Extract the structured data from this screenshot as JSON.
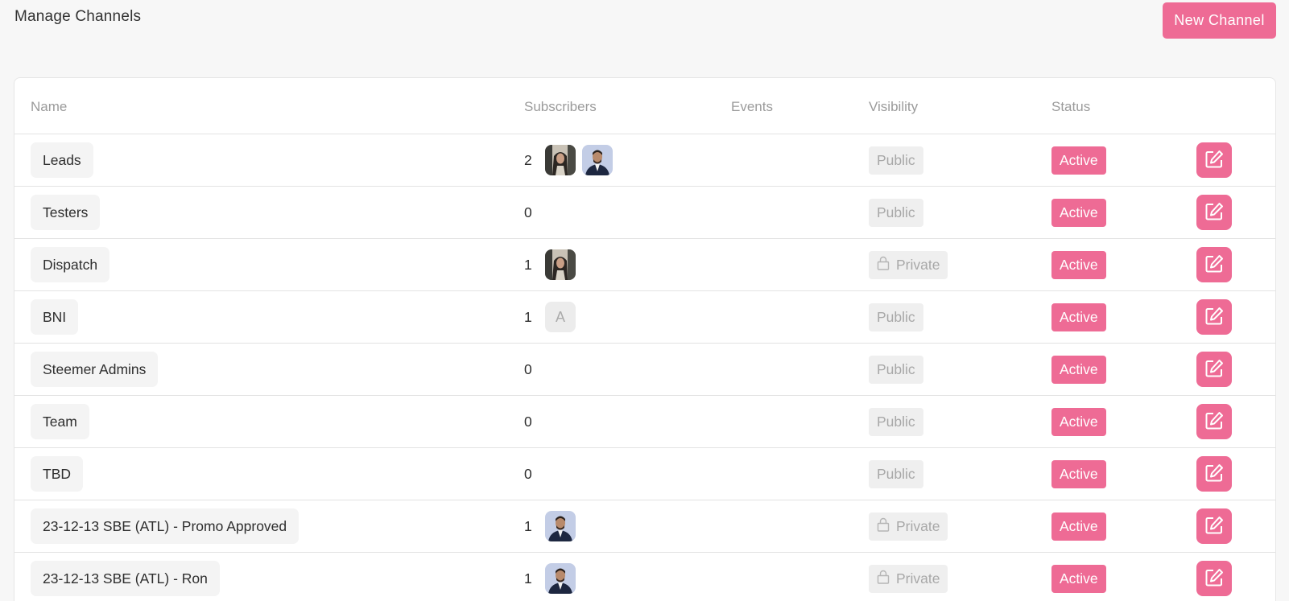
{
  "header": {
    "title": "Manage Channels",
    "new_button_label": "New Channel"
  },
  "table": {
    "columns": {
      "name": "Name",
      "subscribers": "Subscribers",
      "events": "Events",
      "visibility": "Visibility",
      "status": "Status"
    },
    "rows": [
      {
        "name": "Leads",
        "subscriber_count": "2",
        "avatars": [
          "photo-a",
          "photo-b"
        ],
        "visibility": "Public",
        "status": "Active"
      },
      {
        "name": "Testers",
        "subscriber_count": "0",
        "avatars": [],
        "visibility": "Public",
        "status": "Active"
      },
      {
        "name": "Dispatch",
        "subscriber_count": "1",
        "avatars": [
          "photo-a"
        ],
        "visibility": "Private",
        "status": "Active"
      },
      {
        "name": "BNI",
        "subscriber_count": "1",
        "avatars": [
          "letter-A"
        ],
        "avatar_letter": "A",
        "visibility": "Public",
        "status": "Active"
      },
      {
        "name": "Steemer Admins",
        "subscriber_count": "0",
        "avatars": [],
        "visibility": "Public",
        "status": "Active"
      },
      {
        "name": "Team",
        "subscriber_count": "0",
        "avatars": [],
        "visibility": "Public",
        "status": "Active"
      },
      {
        "name": "TBD",
        "subscriber_count": "0",
        "avatars": [],
        "visibility": "Public",
        "status": "Active"
      },
      {
        "name": "23-12-13 SBE (ATL) - Promo Approved",
        "subscriber_count": "1",
        "avatars": [
          "photo-b"
        ],
        "visibility": "Private",
        "status": "Active"
      },
      {
        "name": "23-12-13 SBE (ATL) - Ron",
        "subscriber_count": "1",
        "avatars": [
          "photo-b"
        ],
        "visibility": "Private",
        "status": "Active"
      }
    ]
  },
  "colors": {
    "accent": "#ee6b95",
    "chip_bg": "#f4f4f4",
    "muted_text": "#9b9b9b"
  },
  "icons": {
    "edit": "edit-icon",
    "lock": "lock-icon"
  }
}
